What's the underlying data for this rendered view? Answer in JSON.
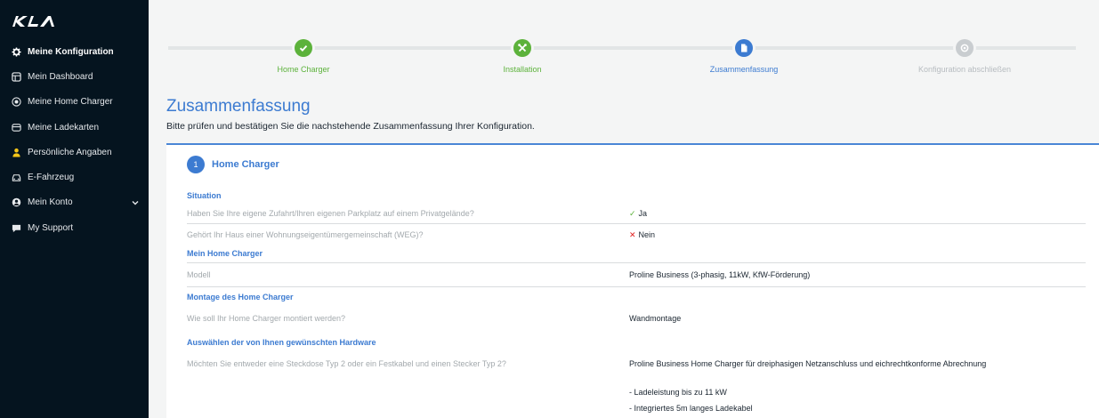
{
  "brand": {
    "logo_text": "KIA"
  },
  "sidebar": {
    "items": [
      {
        "label": "Meine Konfiguration",
        "icon": "gear-icon",
        "active": true
      },
      {
        "label": "Mein Dashboard",
        "icon": "dashboard-icon",
        "active": false
      },
      {
        "label": "Meine Home Charger",
        "icon": "charger-icon",
        "active": false
      },
      {
        "label": "Meine Ladekarten",
        "icon": "card-icon",
        "active": false
      },
      {
        "label": "Persönliche Angaben",
        "icon": "person-icon",
        "active": false
      },
      {
        "label": "E-Fahrzeug",
        "icon": "car-icon",
        "active": false
      },
      {
        "label": "Mein Konto",
        "icon": "account-icon",
        "active": false,
        "has_chevron": true
      },
      {
        "label": "My Support",
        "icon": "chat-icon",
        "active": false
      }
    ]
  },
  "stepper": {
    "steps": [
      {
        "label": "Home Charger",
        "state": "done",
        "icon": "check-icon"
      },
      {
        "label": "Installation",
        "state": "done",
        "icon": "tools-icon"
      },
      {
        "label": "Zusammenfassung",
        "state": "current",
        "icon": "document-icon"
      },
      {
        "label": "Konfiguration abschließen",
        "state": "pending",
        "icon": "flag-icon"
      }
    ]
  },
  "page": {
    "title": "Zusammenfassung",
    "subtitle": "Bitte prüfen und bestätigen Sie die nachstehende Zusammenfassung Ihrer Konfiguration."
  },
  "section": {
    "number": "1",
    "title": "Home Charger",
    "groups": {
      "situation": "Situation",
      "charger": "Mein Home Charger",
      "mounting": "Montage des Home Charger",
      "hardware": "Auswählen der von Ihnen gewünschten Hardware"
    },
    "rows": {
      "parking_q": "Haben Sie Ihre eigene Zufahrt/Ihren eigenen Parkplatz auf einem Privatgelände?",
      "parking_mark": "✓",
      "parking_a": "Ja",
      "weg_q": "Gehört Ihr Haus einer Wohnungseigentümergemeinschaft (WEG)?",
      "weg_mark": "✕",
      "weg_a": "Nein",
      "model_q": "Modell",
      "model_a": "Proline Business (3-phasig, 11kW, KfW-Förderung)",
      "mount_q": "Wie soll Ihr Home Charger montiert werden?",
      "mount_a": "Wandmontage",
      "hw_q": "Möchten Sie entweder eine Steckdose Typ 2 oder ein Festkabel und einen Stecker Typ 2?",
      "hw_a": "Proline Business Home Charger für dreiphasigen Netzanschluss und eichrechtkonforme Abrechnung",
      "hw_b1": "- Ladeleistung bis zu 11 kW",
      "hw_b2": "- Integriertes 5m langes Ladekabel"
    }
  },
  "colors": {
    "sidebar_bg": "#05141f",
    "accent_blue": "#3c7bd1",
    "success_green": "#5cb23b",
    "error_red": "#e02020"
  }
}
